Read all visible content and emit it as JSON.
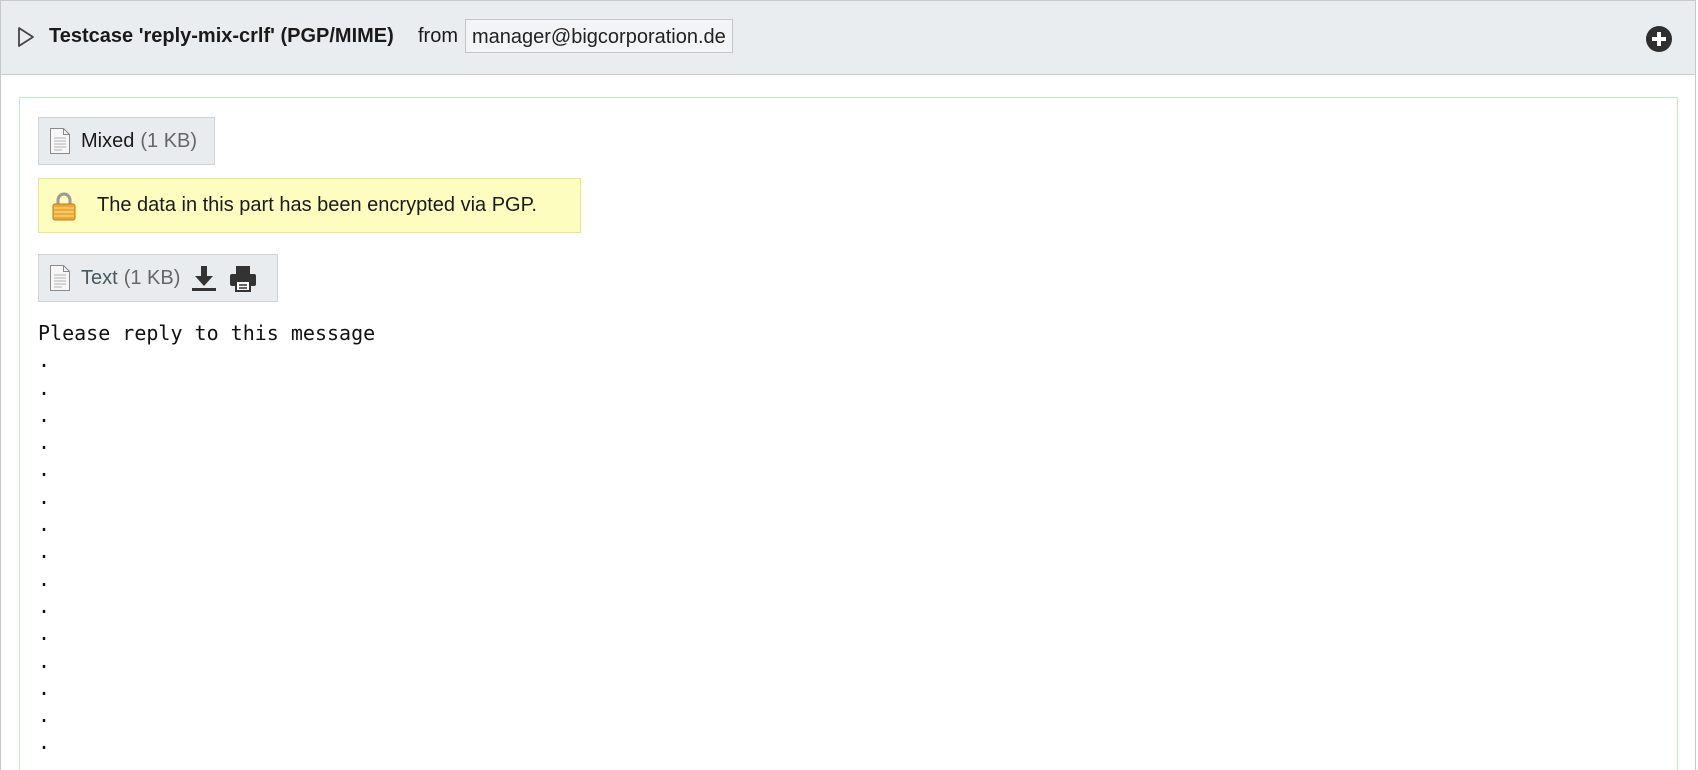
{
  "header": {
    "subject": "Testcase 'reply-mix-crlf' (PGP/MIME)",
    "from_label": "from",
    "sender": "manager@bigcorporation.de",
    "toggle_icon": "triangle-right-icon",
    "expand_icon": "plus-circle-icon"
  },
  "mixed_part": {
    "icon": "document-icon",
    "name": "Mixed",
    "size": "(1 KB)"
  },
  "pgp_notice": {
    "icon": "lock-icon",
    "text": "The data in this part has been encrypted via PGP.",
    "background": "#fdfdc0"
  },
  "text_part": {
    "icon": "document-icon",
    "name": "Text",
    "size": "(1 KB)",
    "download_icon": "download-icon",
    "print_icon": "printer-icon"
  },
  "message_body": "Please reply to this message\n.\n.\n.\n.\n.\n.\n.\n.\n.\n.\n.\n.\n.\n.\n.\n.",
  "colors": {
    "header_bg": "#eaedef",
    "content_border": "#bfeec0",
    "link": "#485860"
  }
}
